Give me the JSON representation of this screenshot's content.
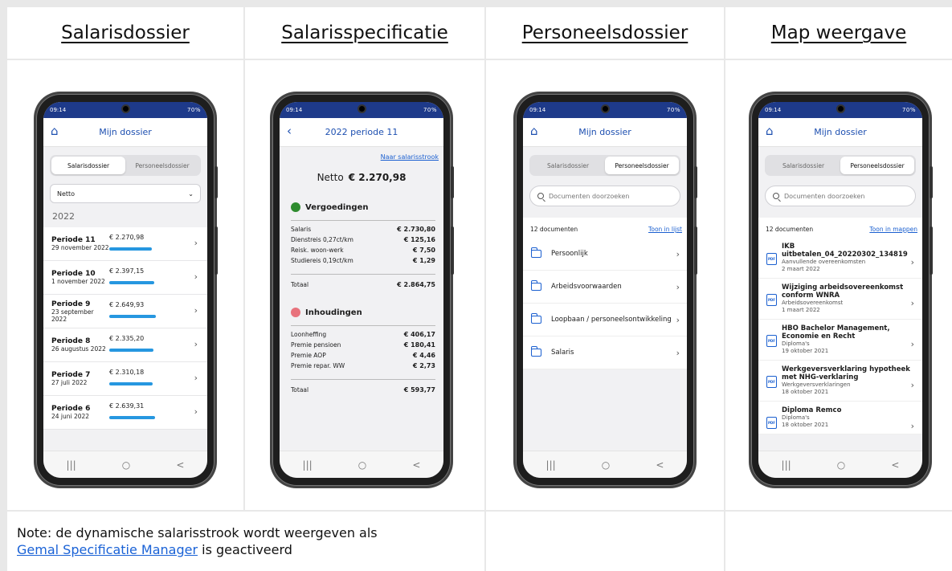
{
  "headers": [
    "Salarisdossier",
    "Salarisspecificatie",
    "Personeelsdossier",
    "Map weergave"
  ],
  "note": {
    "text": "Note: de dynamische salarisstrook wordt weergeven als",
    "link": "Gemal Specificatie Manager",
    "after": "is geactiveerd"
  },
  "status": {
    "time": "09:14",
    "right": "70%"
  },
  "nav": {
    "recent": "|||",
    "home": "○",
    "back": "<"
  },
  "p1": {
    "title": "Mijn dossier",
    "seg": [
      "Salarisdossier",
      "Personeelsdossier"
    ],
    "dropdown": "Netto",
    "year": "2022",
    "rows": [
      {
        "name": "Periode 11",
        "date": "29 november 2022",
        "amount": "€ 2.270,98",
        "fill": 0.92
      },
      {
        "name": "Periode 10",
        "date": "1 november 2022",
        "amount": "€ 2.397,15",
        "fill": 0.97
      },
      {
        "name": "Periode 9",
        "date": "23 september 2022",
        "amount": "€ 2.649,93",
        "fill": 1.0
      },
      {
        "name": "Periode 8",
        "date": "26 augustus 2022",
        "amount": "€ 2.335,20",
        "fill": 0.94
      },
      {
        "name": "Periode 7",
        "date": "27 juli 2022",
        "amount": "€ 2.310,18",
        "fill": 0.93
      },
      {
        "name": "Periode 6",
        "date": "24 juni 2022",
        "amount": "€ 2.639,31",
        "fill": 0.99
      }
    ]
  },
  "p2": {
    "title": "2022 periode 11",
    "link": "Naar salarisstrook",
    "netto_label": "Netto",
    "netto_value": "€ 2.270,98",
    "verg": {
      "title": "Vergoedingen",
      "color": "#2e8b2e",
      "lines": [
        {
          "l": "Salaris",
          "v": "€ 2.730,80"
        },
        {
          "l": "Dienstreis 0,27ct/km",
          "v": "€ 125,16"
        },
        {
          "l": "Reisk. woon-werk",
          "v": "€ 7,50"
        },
        {
          "l": "Studiereis 0,19ct/km",
          "v": "€ 1,29"
        }
      ],
      "total_label": "Totaal",
      "total": "€ 2.864,75"
    },
    "inh": {
      "title": "Inhoudingen",
      "color": "#e8727c",
      "lines": [
        {
          "l": "Loonheffing",
          "v": "€ 406,17"
        },
        {
          "l": "Premie pensioen",
          "v": "€ 180,41"
        },
        {
          "l": "Premie AOP",
          "v": "€ 4,46"
        },
        {
          "l": "Premie repar. WW",
          "v": "€ 2,73"
        }
      ],
      "total_label": "Totaal",
      "total": "€ 593,77"
    }
  },
  "p3": {
    "title": "Mijn dossier",
    "seg": [
      "Salarisdossier",
      "Personeelsdossier"
    ],
    "search": "Documenten doorzoeken",
    "count": "12 documenten",
    "toggle": "Toon in lijst",
    "folders": [
      "Persoonlijk",
      "Arbeidsvoorwaarden",
      "Loopbaan / personeelsontwikkeling",
      "Salaris"
    ]
  },
  "p4": {
    "title": "Mijn dossier",
    "seg": [
      "Salarisdossier",
      "Personeelsdossier"
    ],
    "search": "Documenten doorzoeken",
    "count": "12 documenten",
    "toggle": "Toon in mappen",
    "docs": [
      {
        "t": "IKB uitbetalen_04_20220302_134819",
        "c": "Aanvullende overeenkomsten",
        "d": "2 maart 2022"
      },
      {
        "t": "Wijziging arbeidsovereenkomst conform WNRA",
        "c": "Arbeidsovereenkomst",
        "d": "1 maart 2022"
      },
      {
        "t": "HBO Bachelor Management, Economie en Recht",
        "c": "Diploma's",
        "d": "19 oktober 2021"
      },
      {
        "t": "Werkgeversverklaring hypotheek met NHG-verklaring",
        "c": "Werkgeversverklaringen",
        "d": "18 oktober 2021"
      },
      {
        "t": "Diploma Remco",
        "c": "Diploma's",
        "d": "18 oktober 2021"
      }
    ]
  }
}
